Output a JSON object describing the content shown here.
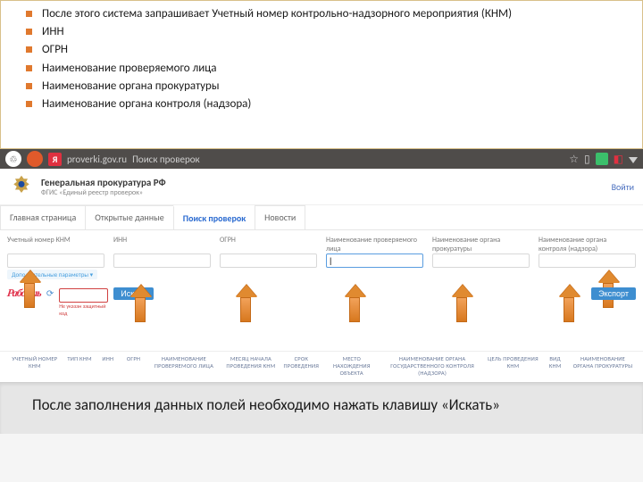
{
  "info": {
    "items": [
      "После этого система запрашивает Учетный номер контрольно-надзорного мероприятия (КНМ)",
      "ИНН",
      "ОГРН",
      "Наименование проверяемого лица",
      "Наименование органа прокуратуры",
      "Наименование органа контроля (надзора)"
    ]
  },
  "browser": {
    "url": "proverki.gov.ru",
    "search_placeholder": "Поиск проверок"
  },
  "header": {
    "title": "Генеральная прокуратура РФ",
    "subtitle": "ФГИС «Единый реестр проверок»",
    "login": "Войти"
  },
  "tabs": [
    {
      "label": "Главная страница"
    },
    {
      "label": "Открытые данные"
    },
    {
      "label": "Поиск проверок"
    },
    {
      "label": "Новости"
    }
  ],
  "filters": [
    {
      "label": "Учетный номер КНМ"
    },
    {
      "label": "ИНН"
    },
    {
      "label": "ОГРН"
    },
    {
      "label": "Наименование проверяемого лица"
    },
    {
      "label": "Наименование органа прокуратуры"
    },
    {
      "label": "Наименование органа контроля (надзора)"
    }
  ],
  "controls": {
    "more_params": "Дополнительные параметры ▾",
    "captcha_text": "Рабость",
    "captcha_error": "Не указан защитный код",
    "search": "Искать",
    "export": "Экспорт"
  },
  "columns": [
    "УЧЕТНЫЙ НОМЕР КНМ",
    "ТИП КНМ",
    "ИНН",
    "ОГРН",
    "НАИМЕНОВАНИЕ ПРОВЕРЯЕМОГО ЛИЦА",
    "МЕСЯЦ НАЧАЛА ПРОВЕДЕНИЯ КНМ",
    "СРОК ПРОВЕДЕНИЯ",
    "МЕСТО НАХОЖДЕНИЯ ОБЪЕКТА",
    "НАИМЕНОВАНИЕ ОРГАНА ГОСУДАРСТВЕННОГО КОНТРОЛЯ (НАДЗОРА)",
    "ЦЕЛЬ ПРОВЕДЕНИЯ КНМ",
    "ВИД КНМ",
    "НАИМЕНОВАНИЕ ОРГАНА ПРОКУРАТУРЫ"
  ],
  "footer": {
    "text": "После заполнения данных полей необходимо нажать клавишу «Искать»"
  }
}
